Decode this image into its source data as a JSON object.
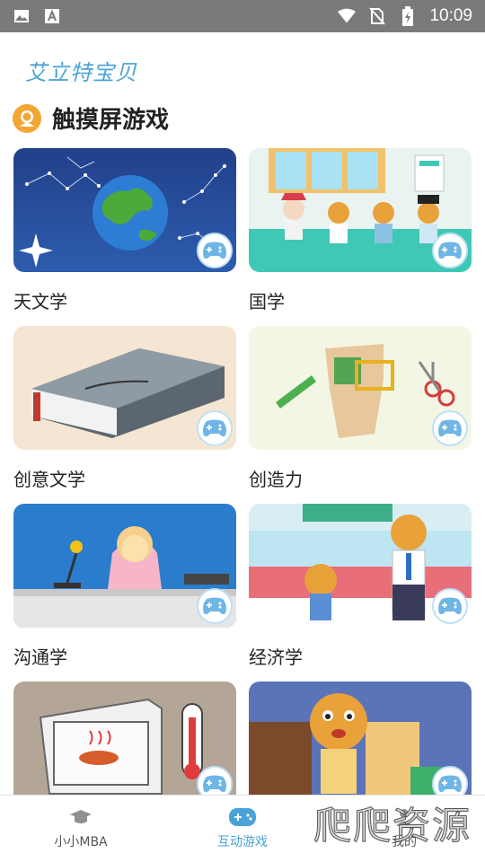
{
  "status_bar": {
    "time": "10:09",
    "icons": [
      "image-icon",
      "font-a-icon",
      "wifi-icon",
      "no-sim-icon",
      "battery-charging-icon"
    ]
  },
  "brand": {
    "name": "艾立特宝贝"
  },
  "section": {
    "title": "触摸屏游戏",
    "icon": "astronaut-icon"
  },
  "cards": [
    {
      "label": "天文学",
      "theme": "#1f3b80",
      "icon": "game-controller-icon"
    },
    {
      "label": "国学",
      "theme": "#3ec9b7",
      "icon": "game-controller-icon"
    },
    {
      "label": "创意文学",
      "theme": "#f3e4cf",
      "icon": "game-controller-icon"
    },
    {
      "label": "创造力",
      "theme": "#f4f7e6",
      "icon": "game-controller-icon"
    },
    {
      "label": "沟通学",
      "theme": "#2b78c8",
      "icon": "game-controller-icon"
    },
    {
      "label": "经济学",
      "theme": "#e86f7a",
      "icon": "game-controller-icon"
    },
    {
      "label": "",
      "theme": "#b0a294",
      "icon": "game-controller-icon"
    },
    {
      "label": "",
      "theme": "#5b74b8",
      "icon": "game-controller-icon"
    }
  ],
  "bottom_nav": {
    "items": [
      {
        "label": "小小MBA",
        "icon": "graduation-cap-icon",
        "active": false
      },
      {
        "label": "互动游戏",
        "icon": "gamepad-icon",
        "active": true
      },
      {
        "label": "我的",
        "icon": "user-icon",
        "active": false
      }
    ]
  },
  "watermark": {
    "text": "爬爬资源"
  },
  "colors": {
    "accent": "#4aa3d6",
    "status_bar": "#7a7a7a",
    "section_icon": "#f3a632"
  }
}
